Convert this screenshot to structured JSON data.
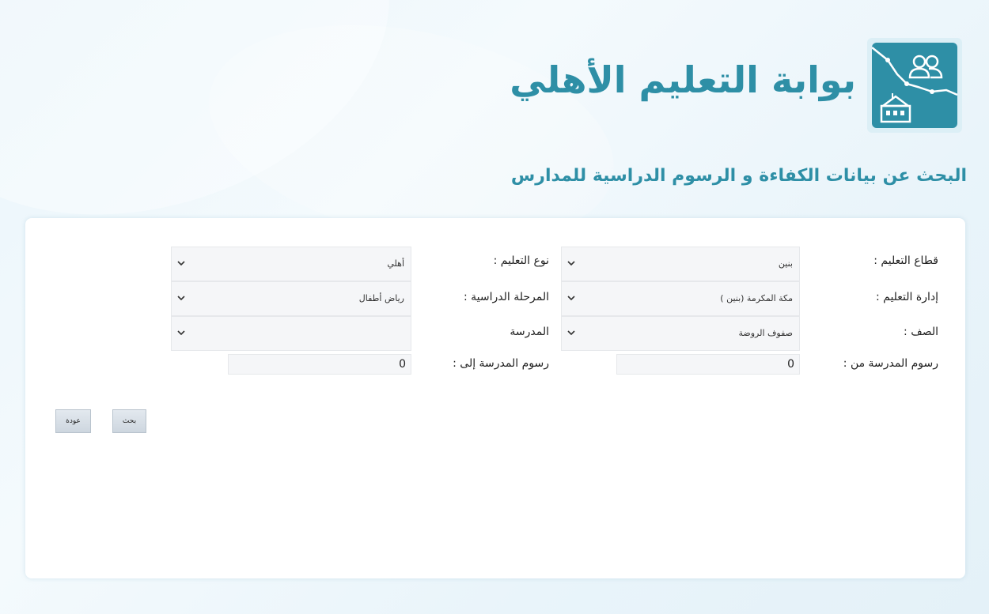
{
  "header": {
    "portal_title": "بوابة التعليم الأهلي",
    "page_heading": "البحث عن بيانات الكفاءة و الرسوم الدراسية للمدارس"
  },
  "form": {
    "sector": {
      "label": "قطاع التعليم :",
      "value": "بنين"
    },
    "education_type": {
      "label": "نوع التعليم :",
      "value": "أهلي"
    },
    "administration": {
      "label": "إدارة التعليم :",
      "value": "مكة المكرمة (بنين )"
    },
    "stage": {
      "label": "المرحلة الدراسية :",
      "value": "رياض أطفال"
    },
    "grade": {
      "label": "الصف :",
      "value": "صفوف الروضة"
    },
    "school": {
      "label": "المدرسة",
      "value": ""
    },
    "fees_from": {
      "label": "رسوم المدرسة من :",
      "value": "0"
    },
    "fees_to": {
      "label": "رسوم المدرسة إلى :",
      "value": "0"
    }
  },
  "buttons": {
    "search": "بحث",
    "back": "عودة"
  },
  "colors": {
    "brand": "#2e8fa6",
    "background": "#eaf5fb",
    "field": "#f5f6f8"
  },
  "icons": {
    "logo": "portal-logo-icon",
    "dropdown": "chevron-down-icon"
  }
}
